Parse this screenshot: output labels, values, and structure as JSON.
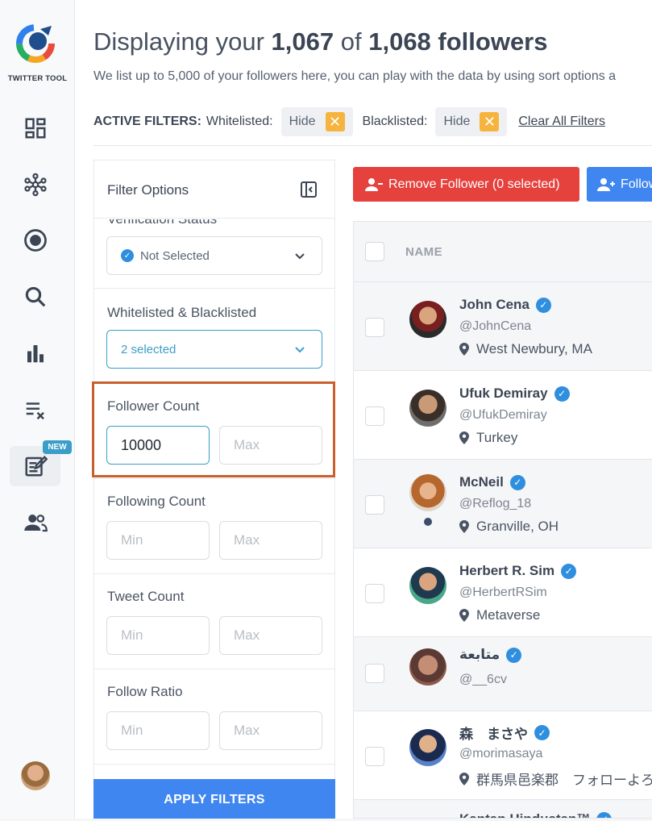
{
  "app": {
    "brand": "TWITTER TOOL",
    "new_badge": "NEW"
  },
  "colors": {
    "accent": "#3a9ec9",
    "apply": "#3f86f0",
    "remove": "#e5413d",
    "highlight": "#c9602b",
    "chip_x": "#f6b33d"
  },
  "rail": {
    "items": [
      {
        "name": "dashboard-icon"
      },
      {
        "name": "network-icon"
      },
      {
        "name": "target-icon"
      },
      {
        "name": "search-icon"
      },
      {
        "name": "bar-chart-icon"
      },
      {
        "name": "clear-list-icon"
      },
      {
        "name": "edit-note-icon"
      },
      {
        "name": "people-icon"
      }
    ]
  },
  "header": {
    "title_pre": "Displaying your ",
    "shown": "1,067",
    "title_mid": " of ",
    "total": "1,068 followers",
    "subtitle": "We list up to 5,000 of your followers here, you can play with the data by using sort options a"
  },
  "active_filters": {
    "label": "ACTIVE FILTERS:",
    "whitelisted_label": "Whitelisted:",
    "whitelisted_value": "Hide",
    "blacklisted_label": "Blacklisted:",
    "blacklisted_value": "Hide",
    "clear_all": "Clear All Filters",
    "remove_glyph": "✕"
  },
  "filter_panel": {
    "title": "Filter Options",
    "verification": {
      "label": "Verification Status",
      "value": "Not Selected"
    },
    "lists": {
      "label": "Whitelisted & Blacklisted",
      "value": "2 selected"
    },
    "follower_count": {
      "label": "Follower Count",
      "min_value": "10000",
      "max_placeholder": "Max"
    },
    "following_count": {
      "label": "Following Count",
      "min_placeholder": "Min",
      "max_placeholder": "Max"
    },
    "tweet_count": {
      "label": "Tweet Count",
      "min_placeholder": "Min",
      "max_placeholder": "Max"
    },
    "follow_ratio": {
      "label": "Follow Ratio",
      "min_placeholder": "Min",
      "max_placeholder": "Max"
    },
    "apply": "APPLY FILTERS"
  },
  "actions": {
    "remove": "Remove Follower (0 selected)",
    "follow": "Follow"
  },
  "table": {
    "name_header": "NAME",
    "rows": [
      {
        "name": "John Cena",
        "handle": "@JohnCena",
        "location": "West Newbury, MA"
      },
      {
        "name": "Ufuk Demiray",
        "handle": "@UfukDemiray",
        "location": "Turkey"
      },
      {
        "name": "McNeil",
        "handle": "@Reflog_18",
        "location": "Granville, OH"
      },
      {
        "name": "Herbert R. Sim",
        "handle": "@HerbertRSim",
        "location": "Metaverse"
      },
      {
        "name": "متابعة",
        "handle": "@__6cv",
        "location": ""
      },
      {
        "name": "森　まさや",
        "handle": "@morimasaya",
        "location": "群馬県邑楽郡　フォローよろ"
      },
      {
        "name": "Kantan Hindustan™",
        "handle": "",
        "location": ""
      }
    ]
  }
}
